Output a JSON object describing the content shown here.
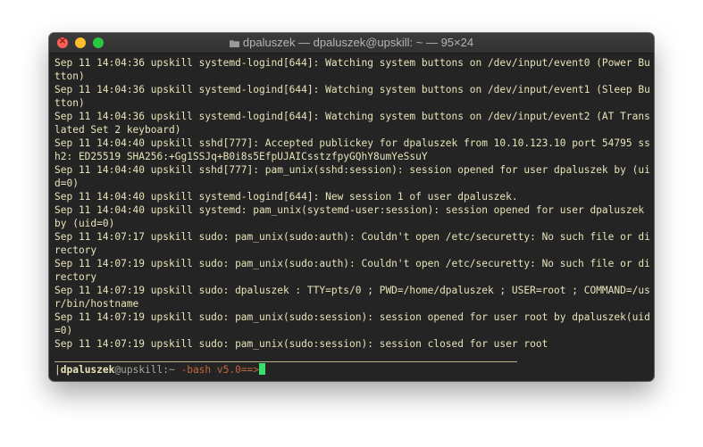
{
  "window": {
    "title": "dpaluszek — dpaluszek@upskill: ~ — 95×24"
  },
  "log_lines": [
    "Sep 11 14:04:36 upskill systemd-logind[644]: Watching system buttons on /dev/input/event0 (Power Button)",
    "Sep 11 14:04:36 upskill systemd-logind[644]: Watching system buttons on /dev/input/event1 (Sleep Button)",
    "Sep 11 14:04:36 upskill systemd-logind[644]: Watching system buttons on /dev/input/event2 (AT Translated Set 2 keyboard)",
    "Sep 11 14:04:40 upskill sshd[777]: Accepted publickey for dpaluszek from 10.10.123.10 port 54795 ssh2: ED25519 SHA256:+Gg1SSJq+B0i8s5EfpUJAICsstzfpyGQhY8umYeSsuY",
    "Sep 11 14:04:40 upskill sshd[777]: pam_unix(sshd:session): session opened for user dpaluszek by (uid=0)",
    "Sep 11 14:04:40 upskill systemd-logind[644]: New session 1 of user dpaluszek.",
    "Sep 11 14:04:40 upskill systemd: pam_unix(systemd-user:session): session opened for user dpaluszek by (uid=0)",
    "Sep 11 14:07:17 upskill sudo: pam_unix(sudo:auth): Couldn't open /etc/securetty: No such file or directory",
    "Sep 11 14:07:19 upskill sudo: pam_unix(sudo:auth): Couldn't open /etc/securetty: No such file or directory",
    "Sep 11 14:07:19 upskill sudo: dpaluszek : TTY=pts/0 ; PWD=/home/dpaluszek ; USER=root ; COMMAND=/usr/bin/hostname",
    "Sep 11 14:07:19 upskill sudo: pam_unix(sudo:session): session opened for user root by dpaluszek(uid=0)",
    "Sep 11 14:07:19 upskill sudo: pam_unix(sudo:session): session closed for user root"
  ],
  "prompt": {
    "bar": "|",
    "user": "dpaluszek",
    "host": "@upskill:~",
    "shell": " -bash v5.0==>"
  },
  "colors": {
    "terminal_bg": "#242424",
    "text": "#e8e3b8",
    "shell_label": "#c2683a",
    "cursor": "#35e06b"
  }
}
